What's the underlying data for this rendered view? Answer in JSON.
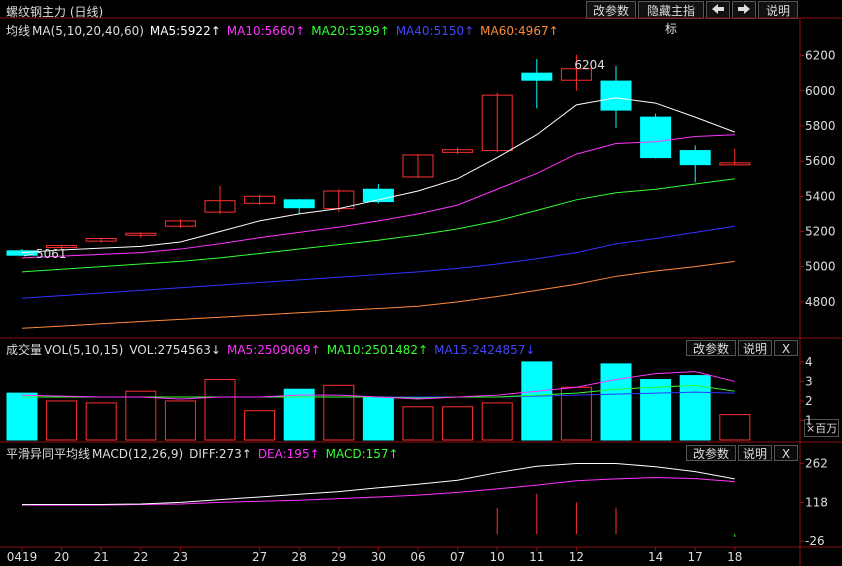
{
  "title": "螺纹钢主力 (日线)",
  "toolbar": {
    "param_label": "改参数",
    "hide_label": "隐藏主指标",
    "prev_icon": "arrow-left-icon",
    "next_icon": "arrow-right-icon",
    "help_label": "说明"
  },
  "colors": {
    "ma5": "#ffffff",
    "ma10": "#ff33ff",
    "ma20": "#33ff33",
    "ma40": "#3333ff",
    "ma60": "#ff8c3a",
    "up": "#ff3030",
    "down": "#00ffff"
  },
  "main_legend": {
    "name": "均线",
    "params": "MA(5,10,20,40,60)",
    "ma5": "MA5:5922↑",
    "ma10": "MA10:5660↑",
    "ma20": "MA20:5399↑",
    "ma40": "MA40:5150↑",
    "ma60": "MA60:4967↑"
  },
  "vol_legend": {
    "name": "成交量",
    "params": "VOL(5,10,15)",
    "vol": "VOL:2754563↓",
    "ma5": "MA5:2509069↑",
    "ma10": "MA10:2501482↑",
    "ma15": "MA15:2424857↓",
    "param_label": "改参数",
    "help_label": "说明",
    "close_label": "X",
    "unit_label": "×百万"
  },
  "macd_legend": {
    "name": "平滑异同平均线",
    "params": "MACD(12,26,9)",
    "diff": "DIFF:273↑",
    "dea": "DEA:195↑",
    "macd": "MACD:157↑",
    "param_label": "改参数",
    "help_label": "说明",
    "close_label": "X"
  },
  "annotations": {
    "low_label": "5061",
    "high_label": "6204"
  },
  "x_labels": [
    "0419",
    "20",
    "21",
    "22",
    "23",
    "27",
    "28",
    "29",
    "30",
    "06",
    "07",
    "10",
    "11",
    "12",
    "14",
    "17",
    "18"
  ],
  "chart_data": [
    {
      "type": "candlestick",
      "title": "螺纹钢主力 (日线)",
      "y_ticks": [
        4800,
        5000,
        5200,
        5400,
        5600,
        5800,
        6000,
        6200
      ],
      "ylim": [
        4600,
        6300
      ],
      "candles": [
        {
          "o": 5090,
          "h": 5100,
          "l": 5061,
          "c": 5065
        },
        {
          "o": 5115,
          "h": 5125,
          "l": 5100,
          "c": 5120
        },
        {
          "o": 5145,
          "h": 5165,
          "l": 5135,
          "c": 5160
        },
        {
          "o": 5180,
          "h": 5195,
          "l": 5165,
          "c": 5190
        },
        {
          "o": 5230,
          "h": 5270,
          "l": 5220,
          "c": 5260
        },
        {
          "o": 5310,
          "h": 5460,
          "l": 5300,
          "c": 5375
        },
        {
          "o": 5360,
          "h": 5410,
          "l": 5350,
          "c": 5400
        },
        {
          "o": 5380,
          "h": 5385,
          "l": 5300,
          "c": 5335
        },
        {
          "o": 5330,
          "h": 5440,
          "l": 5310,
          "c": 5430
        },
        {
          "o": 5440,
          "h": 5470,
          "l": 5360,
          "c": 5370
        },
        {
          "o": 5510,
          "h": 5640,
          "l": 5505,
          "c": 5635
        },
        {
          "o": 5650,
          "h": 5680,
          "l": 5640,
          "c": 5665
        },
        {
          "o": 5660,
          "h": 5990,
          "l": 5650,
          "c": 5975
        },
        {
          "o": 6100,
          "h": 6180,
          "l": 5900,
          "c": 6060
        },
        {
          "o": 6060,
          "h": 6204,
          "l": 6000,
          "c": 6125
        },
        {
          "o": 6055,
          "h": 6140,
          "l": 5790,
          "c": 5890
        },
        {
          "o": 5850,
          "h": 5870,
          "l": 5615,
          "c": 5620
        },
        {
          "o": 5660,
          "h": 5690,
          "l": 5480,
          "c": 5580
        },
        {
          "o": 5590,
          "h": 5670,
          "l": 5580,
          "c": 5590
        }
      ],
      "ma5": [
        5080,
        5095,
        5105,
        5115,
        5140,
        5200,
        5260,
        5300,
        5330,
        5380,
        5430,
        5500,
        5620,
        5750,
        5920,
        5960,
        5930,
        5850,
        5765
      ],
      "ma10": [
        5050,
        5060,
        5070,
        5080,
        5100,
        5130,
        5165,
        5195,
        5225,
        5260,
        5300,
        5350,
        5440,
        5530,
        5640,
        5700,
        5710,
        5740,
        5750
      ],
      "ma20": [
        4970,
        4985,
        5000,
        5015,
        5030,
        5050,
        5075,
        5100,
        5125,
        5150,
        5180,
        5215,
        5260,
        5320,
        5380,
        5420,
        5440,
        5470,
        5500
      ],
      "ma40": [
        4820,
        4835,
        4850,
        4865,
        4880,
        4895,
        4910,
        4925,
        4940,
        4955,
        4970,
        4990,
        5015,
        5045,
        5080,
        5130,
        5160,
        5195,
        5230
      ],
      "ma60": [
        4650,
        4662,
        4675,
        4688,
        4700,
        4712,
        4725,
        4738,
        4750,
        4762,
        4775,
        4800,
        4830,
        4865,
        4900,
        4945,
        4975,
        5000,
        5030
      ]
    },
    {
      "type": "bar",
      "title": "成交量",
      "y_ticks": [
        1,
        2,
        3,
        4
      ],
      "ylim": [
        0,
        4.2
      ],
      "unit": "×百万",
      "values": [
        2.4,
        2.0,
        1.9,
        2.5,
        2.0,
        3.1,
        1.5,
        2.6,
        2.8,
        2.2,
        1.7,
        1.7,
        1.9,
        4.0,
        2.7,
        3.9,
        3.1,
        3.3,
        1.3
      ],
      "up": [
        false,
        true,
        true,
        true,
        true,
        true,
        true,
        false,
        true,
        false,
        true,
        true,
        true,
        false,
        true,
        false,
        false,
        false,
        true
      ],
      "ma5": [
        2.3,
        2.25,
        2.2,
        2.2,
        2.1,
        2.2,
        2.2,
        2.3,
        2.3,
        2.2,
        2.1,
        2.2,
        2.3,
        2.5,
        2.7,
        3.1,
        3.4,
        3.5,
        3.0
      ],
      "ma10": [
        2.2,
        2.2,
        2.2,
        2.2,
        2.2,
        2.2,
        2.2,
        2.2,
        2.2,
        2.2,
        2.15,
        2.2,
        2.2,
        2.3,
        2.4,
        2.6,
        2.7,
        2.8,
        2.5
      ],
      "ma15": [
        2.2,
        2.2,
        2.2,
        2.2,
        2.2,
        2.2,
        2.2,
        2.2,
        2.2,
        2.2,
        2.2,
        2.2,
        2.2,
        2.25,
        2.3,
        2.35,
        2.4,
        2.45,
        2.4
      ]
    },
    {
      "type": "line",
      "title": "平滑异同平均线",
      "y_ticks": [
        -26,
        118,
        262
      ],
      "ylim": [
        -40,
        275
      ],
      "diff": [
        110,
        110,
        110,
        112,
        118,
        128,
        138,
        148,
        158,
        172,
        185,
        200,
        228,
        252,
        262,
        262,
        250,
        232,
        205
      ],
      "dea": [
        108,
        108,
        108,
        110,
        112,
        118,
        122,
        126,
        132,
        138,
        145,
        155,
        168,
        182,
        198,
        205,
        210,
        206,
        195
      ],
      "macd": [
        0,
        0,
        0,
        0,
        0,
        0,
        0,
        0,
        0,
        0,
        0,
        0,
        98,
        150,
        118,
        98,
        0,
        0,
        -10
      ]
    }
  ]
}
